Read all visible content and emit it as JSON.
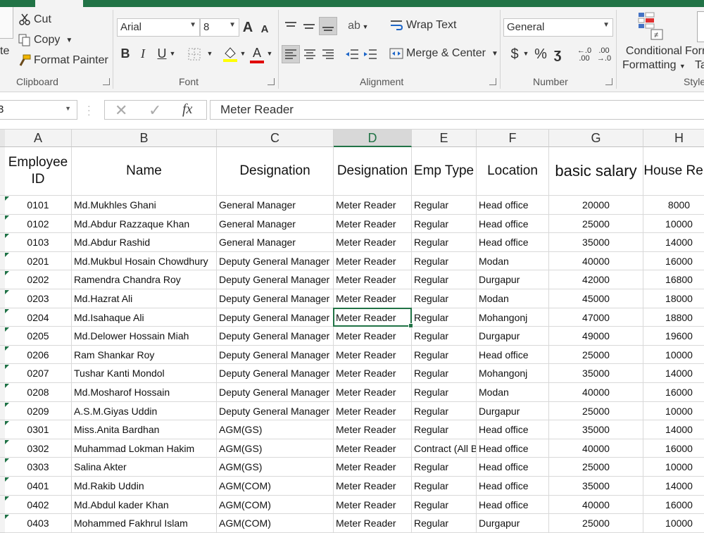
{
  "ribbon": {
    "clipboard": {
      "paste_partial": "te",
      "cut": "Cut",
      "copy": "Copy",
      "format_painter": "Format Painter",
      "group_label": "Clipboard"
    },
    "font": {
      "name": "Arial",
      "size": "8",
      "grow": "A",
      "shrink": "A",
      "bold": "B",
      "italic": "I",
      "underline": "U",
      "font_color_letter": "A",
      "group_label": "Font"
    },
    "alignment": {
      "wrap_text": "Wrap Text",
      "merge_center": "Merge & Center",
      "group_label": "Alignment"
    },
    "number": {
      "format": "General",
      "currency": "$",
      "percent": "%",
      "comma": "ʒ",
      "inc_decimal": "←.0 .00",
      "dec_decimal": ".00 →.0",
      "group_label": "Number"
    },
    "styles": {
      "conditional_line1": "Conditional",
      "conditional_line2": "Formatting",
      "format_as_line1": "Forr",
      "format_as_line2": "Ta",
      "group_label": "Style"
    }
  },
  "formula_bar": {
    "name_box": "3",
    "fx": "fx",
    "value": "Meter Reader"
  },
  "columns": [
    "A",
    "B",
    "C",
    "D",
    "E",
    "F",
    "G",
    "H"
  ],
  "headers": [
    "Employee ID",
    "Name",
    "Designation",
    "Designation",
    "Emp Type",
    "Location",
    "basic salary",
    "House Rent"
  ],
  "rows": [
    [
      "0101",
      "Md.Mukhles Ghani",
      "General Manager",
      "Meter Reader",
      "Regular",
      "Head office",
      "20000",
      "8000"
    ],
    [
      "0102",
      "Md.Abdur Razzaque Khan",
      "General Manager",
      "Meter Reader",
      "Regular",
      "Head office",
      "25000",
      "10000"
    ],
    [
      "0103",
      "Md.Abdur Rashid",
      "General Manager",
      "Meter Reader",
      "Regular",
      "Head office",
      "35000",
      "14000"
    ],
    [
      "0201",
      "Md.Mukbul Hosain Chowdhury",
      "Deputy General Manager",
      "Meter Reader",
      "Regular",
      "Modan",
      "40000",
      "16000"
    ],
    [
      "0202",
      "Ramendra Chandra Roy",
      "Deputy General Manager",
      "Meter Reader",
      "Regular",
      "Durgapur",
      "42000",
      "16800"
    ],
    [
      "0203",
      "Md.Hazrat Ali",
      "Deputy General Manager",
      "Meter Reader",
      "Regular",
      "Modan",
      "45000",
      "18000"
    ],
    [
      "0204",
      "Md.Isahaque Ali",
      "Deputy General Manager",
      "Meter Reader",
      "Regular",
      "Mohangonj",
      "47000",
      "18800"
    ],
    [
      "0205",
      "Md.Delower Hossain Miah",
      "Deputy General Manager",
      "Meter Reader",
      "Regular",
      "Durgapur",
      "49000",
      "19600"
    ],
    [
      "0206",
      "Ram Shankar Roy",
      "Deputy General Manager",
      "Meter Reader",
      "Regular",
      "Head office",
      "25000",
      "10000"
    ],
    [
      "0207",
      "Tushar Kanti Mondol",
      "Deputy General Manager",
      "Meter Reader",
      "Regular",
      "Mohangonj",
      "35000",
      "14000"
    ],
    [
      "0208",
      "Md.Mosharof Hossain",
      "Deputy General Manager",
      "Meter Reader",
      "Regular",
      "Modan",
      "40000",
      "16000"
    ],
    [
      "0209",
      "A.S.M.Giyas Uddin",
      "Deputy General Manager",
      "Meter Reader",
      "Regular",
      "Durgapur",
      "25000",
      "10000"
    ],
    [
      "0301",
      "Miss.Anita Bardhan",
      "AGM(GS)",
      "Meter Reader",
      "Regular",
      "Head office",
      "35000",
      "14000"
    ],
    [
      "0302",
      "Muhammad Lokman Hakim",
      "AGM(GS)",
      "Meter Reader",
      "Contract (All B",
      "Head office",
      "40000",
      "16000"
    ],
    [
      "0303",
      "Salina Akter",
      "AGM(GS)",
      "Meter Reader",
      "Regular",
      "Head office",
      "25000",
      "10000"
    ],
    [
      "0401",
      "Md.Rakib Uddin",
      "AGM(COM)",
      "Meter Reader",
      "Regular",
      "Head office",
      "35000",
      "14000"
    ],
    [
      "0402",
      "Md.Abdul kader Khan",
      "AGM(COM)",
      "Meter Reader",
      "Regular",
      "Head office",
      "40000",
      "16000"
    ],
    [
      "0403",
      "Mohammed Fakhrul Islam",
      "AGM(COM)",
      "Meter Reader",
      "Regular",
      "Durgapur",
      "25000",
      "10000"
    ]
  ],
  "colors": {
    "accent": "#217346",
    "ribbon_bg": "#f3f3f3",
    "header_bg": "#f3f3f3",
    "gridline": "#d9d9d9"
  }
}
